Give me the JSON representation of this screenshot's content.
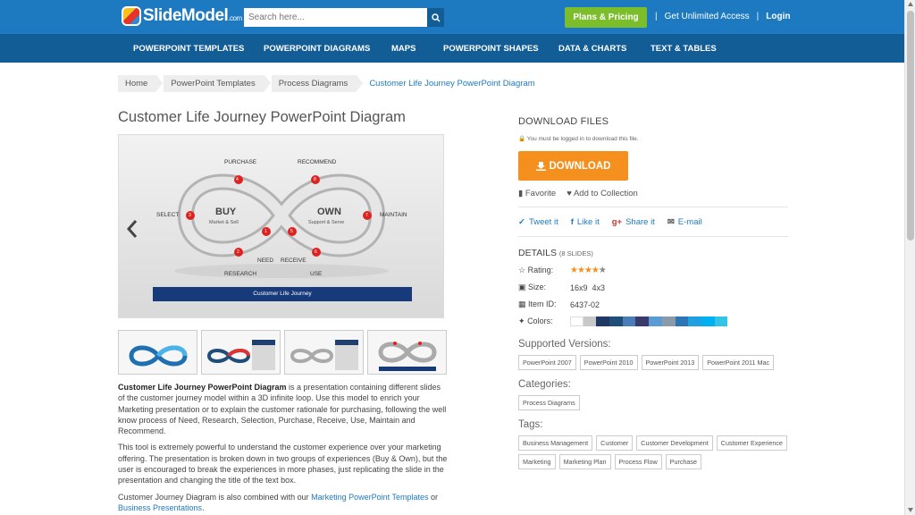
{
  "header": {
    "logo_text": "SlideModel",
    "logo_suffix": ".com",
    "search_placeholder": "Search here...",
    "plans_label": "Plans & Pricing",
    "unlimited_label": "Get Unlimited Access",
    "login_label": "Login",
    "separator": "|"
  },
  "nav": {
    "items": [
      "POWERPOINT TEMPLATES",
      "POWERPOINT DIAGRAMS",
      "MAPS",
      "POWERPOINT SHAPES",
      "DATA & CHARTS",
      "TEXT & TABLES"
    ]
  },
  "breadcrumb": {
    "items": [
      "Home",
      "PowerPoint Templates",
      "Process Diagrams"
    ],
    "current": "Customer Life Journey PowerPoint Diagram"
  },
  "product": {
    "title": "Customer Life Journey PowerPoint Diagram",
    "diagram": {
      "labels": {
        "purchase": "PURCHASE",
        "recommend": "RECOMMEND",
        "select": "SELECT",
        "maintain": "MAINTAIN",
        "need": "NEED",
        "receive": "RECEIVE",
        "research": "RESEARCH",
        "use": "USE",
        "buy": "BUY",
        "buy_sub": "Market & Sell",
        "own": "OWN",
        "own_sub": "Support & Serve"
      },
      "numbers": [
        "1",
        "2",
        "3",
        "4",
        "5",
        "6",
        "7",
        "8"
      ],
      "bar_title": "Customer Life Journey"
    }
  },
  "description": {
    "p1_bold": "Customer Life Journey PowerPoint Diagram",
    "p1_rest": " is a presentation containing different slides of the customer journey model within a 3D infinite loop. Use this model to enrich your Marketing presentation or to explain the customer rationale for purchasing, following the well know process of Need, Research, Selection, Purchase, Receive, Use, Maintain and Recommend.",
    "p2": "This tool is extremely powerful to understand the customer experience over your marketing offering. The presentation is broken down in two groups of experiences (Buy & Own), but the user is encouraged to break the experiences in more phases, just replicating the slide in the presentation and changing the title of the text box.",
    "p3_start": "Customer Journey Diagram is also combined with  our ",
    "p3_link1": "Marketing PowerPoint Templates",
    "p3_mid": " or ",
    "p3_link2": "Business Presentations",
    "p3_end": "."
  },
  "download": {
    "title": "DOWNLOAD FILES",
    "note": "You must be logged in to download this file.",
    "button_label": "DOWNLOAD",
    "favorite_label": "Favorite",
    "collection_label": "Add to Collection",
    "share": {
      "tweet": "Tweet it",
      "like": "Like it",
      "share": "Share it",
      "email": "E-mail"
    }
  },
  "details": {
    "title": "DETAILS",
    "slides_note": "(8 SLIDES)",
    "rating_label": "Rating:",
    "rating_value": 4.5,
    "rating_max": 5,
    "size_label": "Size:",
    "size_value": "16x9  4x3",
    "item_id_label": "Item ID:",
    "item_id_value": "6437-02",
    "colors_label": "Colors:",
    "colors": [
      "#ffffff",
      "#c8c8c8",
      "#203864",
      "#1f4e79",
      "#4a7cb5",
      "#3b3b6b",
      "#5b9bd5",
      "#8a9aa8",
      "#2e75b6",
      "#1fa0e0",
      "#00b0f0",
      "#33c3e6"
    ]
  },
  "supported_versions": {
    "title": "Supported Versions:",
    "items": [
      "PowerPoint 2007",
      "PowerPoint 2010",
      "PowerPoint 2013",
      "PowerPoint 2011 Mac"
    ]
  },
  "categories": {
    "title": "Categories:",
    "items": [
      "Process Diagrams"
    ]
  },
  "tags": {
    "title": "Tags:",
    "items": [
      "Business Management",
      "Customer",
      "Customer Development",
      "Customer Experience",
      "Marketing",
      "Marketing Plan",
      "Process Flow",
      "Purchase"
    ]
  }
}
